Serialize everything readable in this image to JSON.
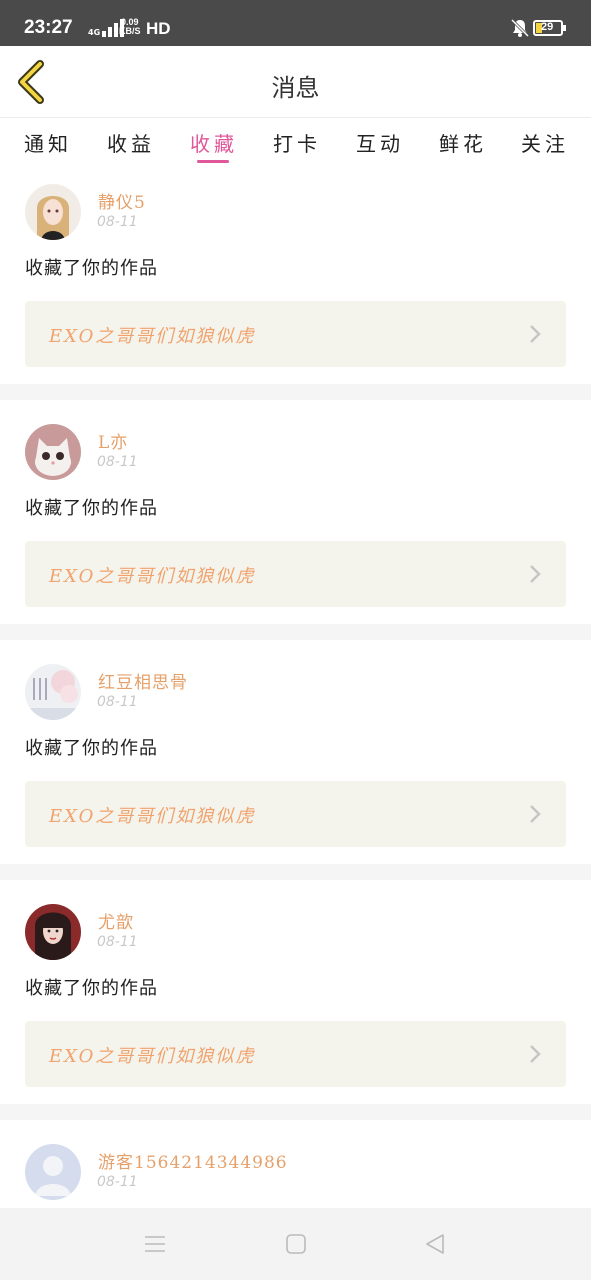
{
  "status_bar": {
    "time": "23:27",
    "network": "4G",
    "speed_value": "0.09",
    "speed_unit": "KB/S",
    "hd": "HD",
    "battery": "29",
    "battery_color": "#f5d442"
  },
  "header": {
    "back_icon": "chevron-left-icon",
    "title": "消息"
  },
  "tabs": [
    {
      "label": "通知",
      "active": false
    },
    {
      "label": "收益",
      "active": false
    },
    {
      "label": "收藏",
      "active": true
    },
    {
      "label": "打卡",
      "active": false
    },
    {
      "label": "互动",
      "active": false
    },
    {
      "label": "鲜花",
      "active": false
    },
    {
      "label": "关注",
      "active": false
    }
  ],
  "accent_color": "#e0589a",
  "messages": [
    {
      "username": "静仪5",
      "date": "08-11",
      "action": "收藏了你的作品",
      "work_title": "EXO之哥哥们如狼似虎",
      "avatar": "avatar-girl-blonde"
    },
    {
      "username": "L亦",
      "date": "08-11",
      "action": "收藏了你的作品",
      "work_title": "EXO之哥哥们如狼似虎",
      "avatar": "avatar-cat"
    },
    {
      "username": "红豆相思骨",
      "date": "08-11",
      "action": "收藏了你的作品",
      "work_title": "EXO之哥哥们如狼似虎",
      "avatar": "avatar-blossom"
    },
    {
      "username": "尤歆",
      "date": "08-11",
      "action": "收藏了你的作品",
      "work_title": "EXO之哥哥们如狼似虎",
      "avatar": "avatar-girl-red"
    },
    {
      "username": "游客1564214344986",
      "date": "08-11",
      "action": "",
      "work_title": "",
      "avatar": "avatar-default-user"
    }
  ],
  "nav_buttons": [
    "menu-icon",
    "home-icon",
    "back-triangle-icon"
  ]
}
